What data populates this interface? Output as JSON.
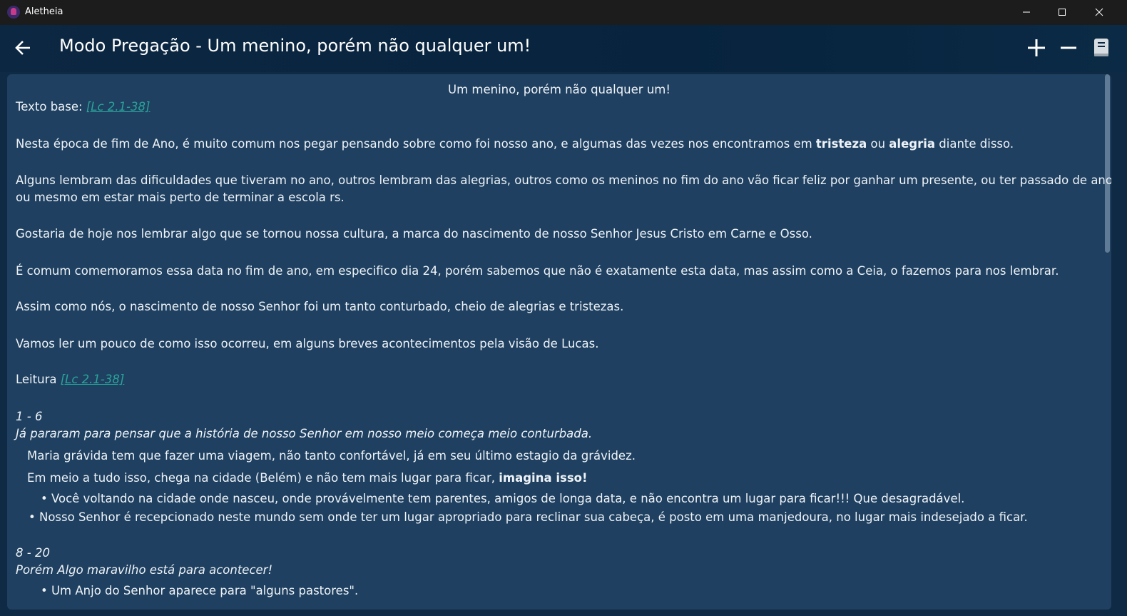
{
  "window": {
    "title": "Aletheia",
    "buttons": [
      "minimize-icon",
      "maximize-icon",
      "close-icon"
    ]
  },
  "appbar": {
    "title": "Modo Pregação - Um menino, porém não qualquer um!",
    "icons": [
      "back-arrow-icon",
      "plus-icon",
      "minus-icon",
      "book-icon"
    ]
  },
  "doc": {
    "heading": "Um menino, porém não qualquer um!",
    "texto_label": "Texto base: ",
    "ref1": "[Lc 2.1-38]",
    "p1_a": "Nesta época de fim de Ano, é muito comum nos pegar pensando sobre como foi nosso ano, e algumas das vezes nos encontramos em ",
    "p1_b1": "tristeza",
    "p1_c": " ou ",
    "p1_b2": "alegria",
    "p1_d": " diante disso.",
    "p2_line1": "Alguns lembram das dificuldades que tiveram no ano, outros lembram das alegrias, outros como os meninos no fim do ano vão ficar feliz por ganhar um presente, ou ter passado de ano,",
    "p2_line2": "ou mesmo em estar mais perto de terminar a escola rs.",
    "p3": "Gostaria de hoje nos lembrar algo que se tornou nossa cultura, a marca do nascimento de nosso Senhor Jesus Cristo em Carne e Osso.",
    "p4": "É comum comemoramos essa data no fim de ano, em especifico dia 24, porém sabemos que não é exatamente esta data, mas assim como a Ceia, o fazemos para nos lembrar.",
    "p5": "Assim como nós, o nascimento de nosso Senhor foi um tanto conturbado, cheio de alegrias e tristezas.",
    "p6": "Vamos ler um pouco de como isso ocorreu, em alguns breves acontecimentos pela visão de Lucas.",
    "leitura_label": "Leitura ",
    "ref2": "[Lc 2.1-38]",
    "sec1_verses": "1 - 6",
    "sec1_intro": "Já pararam para pensar que a história de nosso Senhor em nosso meio começa meio conturbada.",
    "sec1_l1": "Maria grávida tem que fazer uma viagem, não tanto confortável, já em seu último estagio da grávidez.",
    "sec1_l2_a": "Em meio a tudo isso, chega na cidade (Belém) e não tem mais lugar para ficar, ",
    "sec1_l2_b": "imagina isso!",
    "sec1_b1": "Você voltando na cidade onde nasceu, onde provávelmente tem parentes, amigos de longa data, e não encontra um lugar para ficar!!! Que desagradável.",
    "sec1_b2": "Nosso Senhor é recepcionado neste mundo sem onde ter um lugar apropriado para reclinar sua cabeça, é posto em uma  manjedoura, no lugar mais indesejado a ficar.",
    "sec2_verses": "8 - 20",
    "sec2_intro": "Porém Algo maravilho está para acontecer!",
    "sec2_b1": "Um Anjo do Senhor aparece para \"alguns pastores\"."
  }
}
